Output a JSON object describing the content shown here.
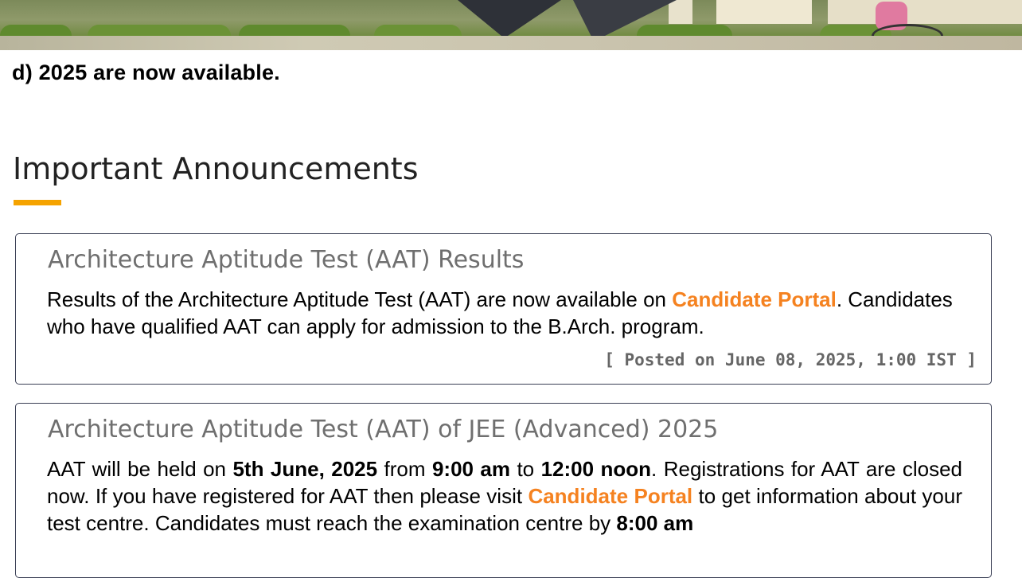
{
  "banner": {
    "alt": "Campus photo banner"
  },
  "intro": {
    "truncated_text": "d) 2025 are now available."
  },
  "announcements": {
    "heading": "Important Announcements",
    "colors": {
      "accent": "#f5a300",
      "link": "#f58220",
      "card_border": "#3a3f55",
      "card_title": "#6f6f6f"
    },
    "items": [
      {
        "title": "Architecture Aptitude Test (AAT) Results",
        "body_part1": "Results of the Architecture Aptitude Test (AAT) are now available on ",
        "link_text": "Candidate Portal",
        "body_part2": ". Candidates who have qualified AAT can apply for admission to the B.Arch. program.",
        "posted": "[ Posted on June 08, 2025, 1:00 IST ]"
      },
      {
        "title": "Architecture Aptitude Test (AAT) of JEE (Advanced) 2025",
        "body_1": "AAT will be held on ",
        "date_bold": "5th June, 2025",
        "body_2": " from ",
        "start_bold": "9:00 am",
        "body_3": " to ",
        "end_bold": "12:00 noon",
        "body_4": ". Registrations for AAT are closed now. If you have registered for AAT then please visit ",
        "link_text": "Candidate Portal",
        "body_5": " to get information about your test centre. Candidates must reach the examination centre by ",
        "reach_bold": "8:00 am"
      }
    ]
  }
}
